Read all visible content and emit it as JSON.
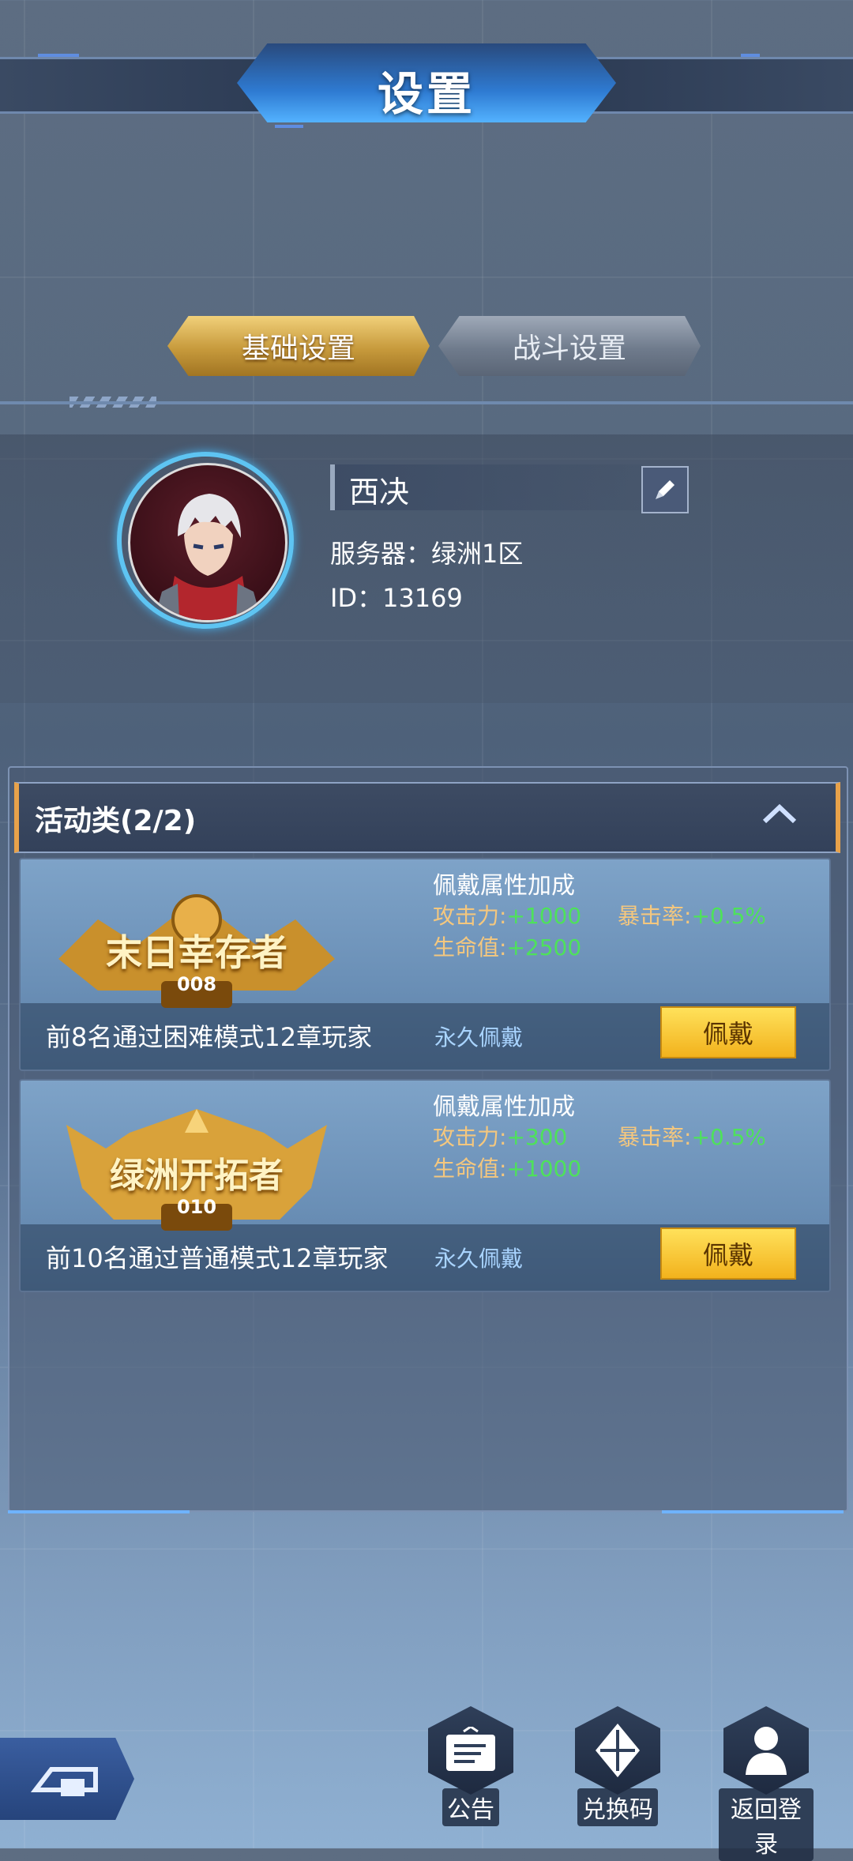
{
  "header": {
    "title": "设置"
  },
  "tabs": [
    {
      "label": "基础设置",
      "active": true
    },
    {
      "label": "战斗设置",
      "active": false
    }
  ],
  "profile": {
    "name": "西决",
    "server": "服务器：绿洲1区",
    "id": "ID：13169"
  },
  "section": {
    "title": "活动类(2/2)"
  },
  "titles": [
    {
      "badge_text": "末日幸存者",
      "badge_number": "008",
      "bonus_title": "佩戴属性加成",
      "attack_label": "攻击力:",
      "attack_value": "+1000",
      "hp_label": "生命值:",
      "hp_value": "+2500",
      "crit_label": "暴击率:",
      "crit_value": "+0.5%",
      "description": "前8名通过困难模式12章玩家",
      "duration": "永久佩戴",
      "button": "佩戴"
    },
    {
      "badge_text": "绿洲开拓者",
      "badge_number": "010",
      "bonus_title": "佩戴属性加成",
      "attack_label": "攻击力:",
      "attack_value": "+300",
      "hp_label": "生命值:",
      "hp_value": "+1000",
      "crit_label": "暴击率:",
      "crit_value": "+0.5%",
      "description": "前10名通过普通模式12章玩家",
      "duration": "永久佩戴",
      "button": "佩戴"
    }
  ],
  "bottom_nav": [
    {
      "label": "公告",
      "icon": "notice-board-icon"
    },
    {
      "label": "兑换码",
      "icon": "diamond-icon"
    },
    {
      "label": "返回登录",
      "icon": "user-icon"
    }
  ],
  "colors": {
    "gold": "#f2b21d",
    "accent_blue": "#5ec4f2",
    "bonus_green": "#4ee25a",
    "stat_label": "#f4c77e"
  }
}
